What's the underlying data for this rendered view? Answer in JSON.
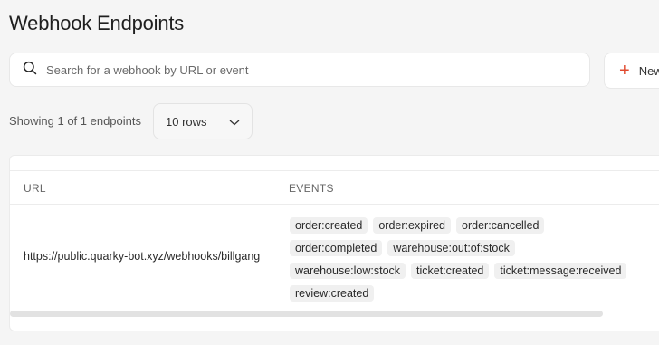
{
  "header": {
    "title": "Webhook Endpoints"
  },
  "search": {
    "placeholder": "Search for a webhook by URL or event",
    "value": ""
  },
  "toolbar": {
    "new_label": "New"
  },
  "pagination": {
    "showing": "Showing 1 of 1 endpoints",
    "rows_select": "10 rows"
  },
  "table": {
    "columns": [
      "URL",
      "EVENTS"
    ],
    "rows": [
      {
        "url": "https://public.quarky-bot.xyz/webhooks/billgang",
        "events": [
          "order:created",
          "order:expired",
          "order:cancelled",
          "order:completed",
          "warehouse:out:of:stock",
          "warehouse:low:stock",
          "ticket:created",
          "ticket:message:received",
          "review:created"
        ]
      }
    ]
  },
  "colors": {
    "accent": "#e04a2f",
    "background": "#f5f5f5",
    "badge": "#f0f0f0"
  },
  "icons": {
    "search": "search-icon",
    "add": "plus-icon",
    "dropdown": "chevron-down-icon"
  }
}
